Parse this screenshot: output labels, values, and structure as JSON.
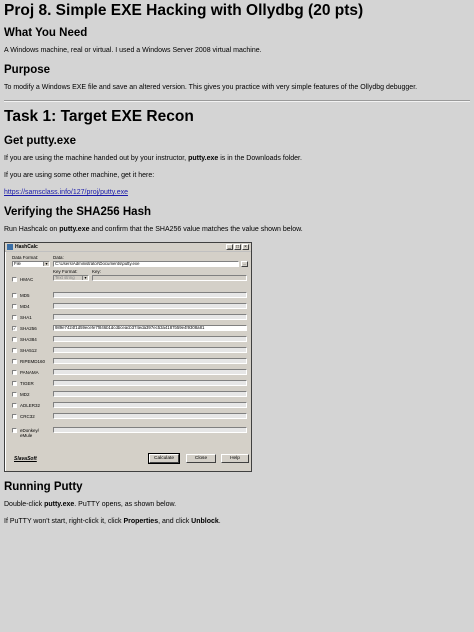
{
  "header": {
    "title": "Proj 8. Simple EXE Hacking with Ollydbg (20 pts)"
  },
  "need": {
    "heading": "What You Need",
    "text": "A Windows machine, real or virtual. I used a Windows Server 2008 virtual machine."
  },
  "purpose": {
    "heading": "Purpose",
    "text": "To modify a Windows EXE file and save an altered version. This gives you practice with very simple features of the Ollydbg debugger."
  },
  "task1": {
    "heading": "Task 1: Target EXE Recon"
  },
  "getputty": {
    "heading": "Get putty.exe",
    "p1_pre": "If you are using the machine handed out by your instructor, ",
    "p1_bold": "putty.exe",
    "p1_post": " is in the Downloads folder.",
    "p2": "If you are using some other machine, get it here:",
    "link": "https://samsclass.info/127/proj/putty.exe"
  },
  "verify": {
    "heading": "Verifying the SHA256 Hash",
    "p_pre": "Run Hashcalc on ",
    "p_bold": "putty.exe",
    "p_post": " and confirm that the SHA256 value matches the value shown below."
  },
  "hashcalc": {
    "title": "HashCalc",
    "data_format_label": "Data Format:",
    "data_format_value": "File",
    "data_label": "Data:",
    "data_value": "C:\\Users\\Administrator\\Documents\\putty.exe",
    "key_format_label": "Key Format:",
    "key_format_value": "Text string",
    "key_label": "Key:",
    "hmac_label": "HMAC",
    "algorithms": [
      {
        "name": "MD5",
        "checked": false,
        "value": ""
      },
      {
        "name": "MD4",
        "checked": false,
        "value": ""
      },
      {
        "name": "SHA1",
        "checked": false,
        "value": ""
      },
      {
        "name": "SHA256",
        "checked": true,
        "value": "989e7424f1d59ecefe7f846b1dcdbceacb374eda397ec53a4187b59e4f9308a81"
      },
      {
        "name": "SHA384",
        "checked": false,
        "value": ""
      },
      {
        "name": "SHA512",
        "checked": false,
        "value": ""
      },
      {
        "name": "RIPEMD160",
        "checked": false,
        "value": ""
      },
      {
        "name": "PANAMA",
        "checked": false,
        "value": ""
      },
      {
        "name": "TIGER",
        "checked": false,
        "value": ""
      },
      {
        "name": "MD2",
        "checked": false,
        "value": ""
      },
      {
        "name": "ADLER32",
        "checked": false,
        "value": ""
      },
      {
        "name": "CRC32",
        "checked": false,
        "value": ""
      },
      {
        "name": "eDonkey/ eMule",
        "checked": false,
        "value": ""
      }
    ],
    "logo": "SlavaSoft",
    "calculate": "Calculate",
    "close": "Close",
    "help": "Help"
  },
  "running": {
    "heading": "Running Putty",
    "p1_pre": "Double-click ",
    "p1_bold": "putty.exe",
    "p1_post": ". PuTTY opens, as shown below.",
    "p2_pre": "If PuTTY won't start, right-click it, click ",
    "p2_bold1": "Properties",
    "p2_mid": ", and click ",
    "p2_bold2": "Unblock",
    "p2_post": "."
  }
}
